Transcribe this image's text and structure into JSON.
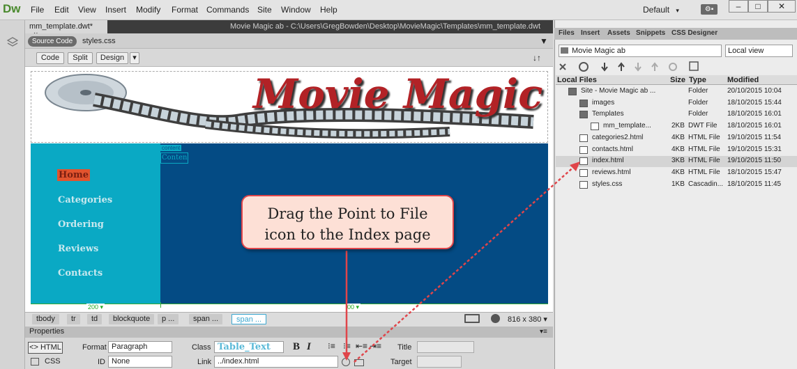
{
  "app": {
    "logo": "Dw",
    "workspace": "Default",
    "workspace_caret": "▾",
    "win_min": "–",
    "win_max": "□",
    "win_close": "✕"
  },
  "menu": [
    "File",
    "Edit",
    "View",
    "Insert",
    "Modify",
    "Format",
    "Commands",
    "Site",
    "Window",
    "Help"
  ],
  "doc": {
    "tab_label": "mm_template.dwt*",
    "tab_close": "×",
    "path": "Movie Magic ab - C:\\Users\\GregBowden\\Desktop\\MovieMagic\\Templates\\mm_template.dwt",
    "source_code": "Source Code",
    "related_file": "styles.css",
    "view_buttons": [
      "Code",
      "Split",
      "Design"
    ],
    "view_caret": "▾"
  },
  "page": {
    "banner_title": "Movie Magic",
    "nav": [
      "Home",
      "Categories",
      "Ordering",
      "Reviews",
      "Contacts"
    ],
    "content_label": "content",
    "content_box": "Conten",
    "ruler_left": "200 ▾",
    "ruler_right": "00 ▾"
  },
  "tag_selector": {
    "tags": [
      "tbody",
      "tr",
      "td",
      "blockquote",
      "p ...",
      "span ...",
      "span ..."
    ],
    "size": "816 x 380 ▾"
  },
  "properties": {
    "header": "Properties",
    "html_button": "<> HTML",
    "css_button": "CSS",
    "format_label": "Format",
    "format_value": "Paragraph",
    "id_label": "ID",
    "id_value": "None",
    "class_label": "Class",
    "class_value": "Table_Text",
    "link_label": "Link",
    "link_value": "../index.html",
    "title_label": "Title",
    "target_label": "Target",
    "bold": "B",
    "italic": "I"
  },
  "files_panel": {
    "tabs": [
      "Files",
      "Insert",
      "Assets",
      "Snippets",
      "CSS Designer"
    ],
    "site": "Movie Magic ab",
    "view": "Local view",
    "columns": [
      "Local Files",
      "Size",
      "Type",
      "Modified"
    ],
    "rows": [
      {
        "name": "Site - Movie Magic ab ...",
        "size": "",
        "type": "Folder",
        "modified": "20/10/2015 10:04",
        "indent": 0,
        "icon": "folder-icon"
      },
      {
        "name": "images",
        "size": "",
        "type": "Folder",
        "modified": "18/10/2015 15:44",
        "indent": 1,
        "icon": "folder-icon"
      },
      {
        "name": "Templates",
        "size": "",
        "type": "Folder",
        "modified": "18/10/2015 16:01",
        "indent": 1,
        "icon": "folder-icon"
      },
      {
        "name": "mm_template...",
        "size": "2KB",
        "type": "DWT File",
        "modified": "18/10/2015 16:01",
        "indent": 2,
        "icon": "dwt-file-icon"
      },
      {
        "name": "categories2.html",
        "size": "4KB",
        "type": "HTML File",
        "modified": "19/10/2015 11:54",
        "indent": 1,
        "icon": "html-file-icon"
      },
      {
        "name": "contacts.html",
        "size": "4KB",
        "type": "HTML File",
        "modified": "19/10/2015 15:31",
        "indent": 1,
        "icon": "html-file-icon"
      },
      {
        "name": "index.html",
        "size": "3KB",
        "type": "HTML File",
        "modified": "19/10/2015 11:50",
        "indent": 1,
        "icon": "html-file-icon",
        "selected": true
      },
      {
        "name": "reviews.html",
        "size": "4KB",
        "type": "HTML File",
        "modified": "18/10/2015 15:47",
        "indent": 1,
        "icon": "html-file-icon"
      },
      {
        "name": "styles.css",
        "size": "1KB",
        "type": "Cascadin...",
        "modified": "18/10/2015 11:45",
        "indent": 1,
        "icon": "css-file-icon"
      }
    ]
  },
  "callout": {
    "line1": "Drag the Point to File",
    "line2": "icon to the Index page"
  },
  "colors": {
    "nav_bg": "#0aa9c4",
    "content_bg": "#044b84",
    "home_bg": "#e2542e",
    "arrow": "#e0454a"
  }
}
